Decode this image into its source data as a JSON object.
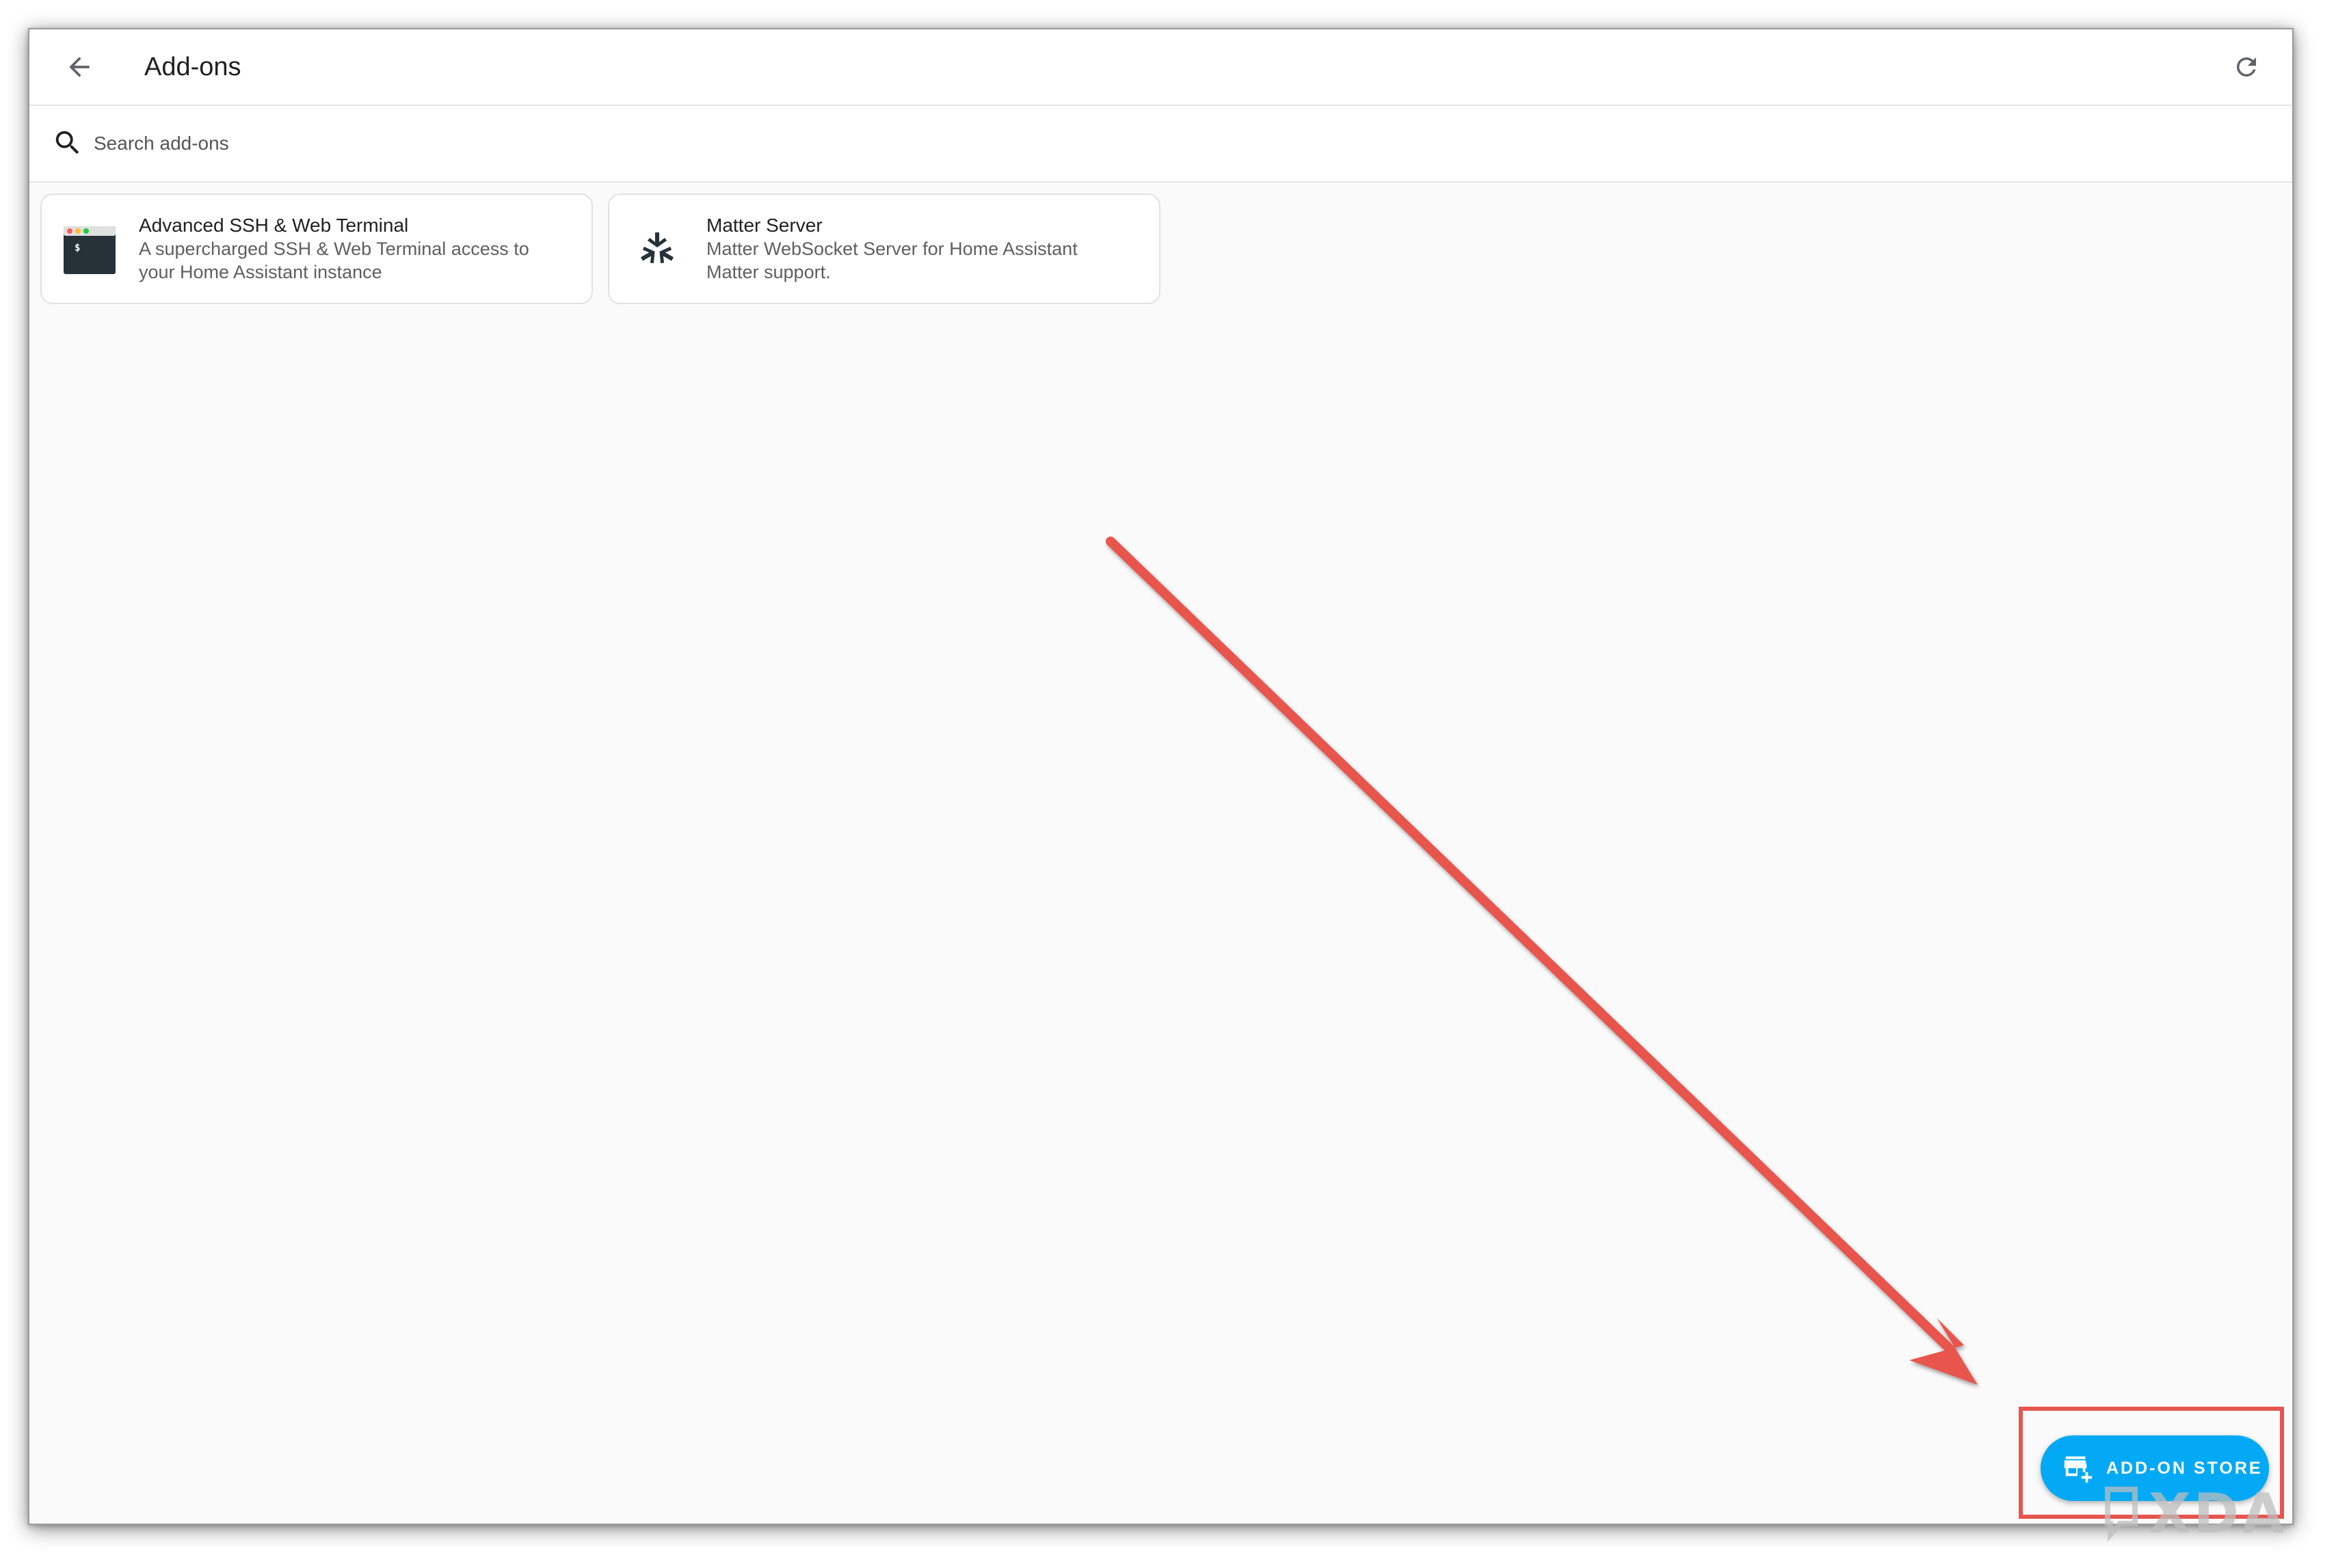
{
  "header": {
    "title": "Add-ons",
    "back_icon": "arrow-left-icon",
    "refresh_icon": "refresh-icon"
  },
  "search": {
    "placeholder": "Search add-ons",
    "value": "",
    "icon": "search-icon"
  },
  "addons": [
    {
      "title": "Advanced SSH & Web Terminal",
      "description_line1": "A supercharged SSH & Web Terminal access to",
      "description_line2": "your Home Assistant instance",
      "icon": "terminal-icon"
    },
    {
      "title": "Matter Server",
      "description_line1": "Matter WebSocket Server for Home Assistant",
      "description_line2": "Matter support.",
      "icon": "matter-logo-icon"
    }
  ],
  "fab": {
    "label": "ADD-ON STORE",
    "icon": "store-plus-icon",
    "color": "#03a9f4"
  },
  "annotation": {
    "color": "#e8544e"
  },
  "watermark": {
    "text": "XDA"
  }
}
